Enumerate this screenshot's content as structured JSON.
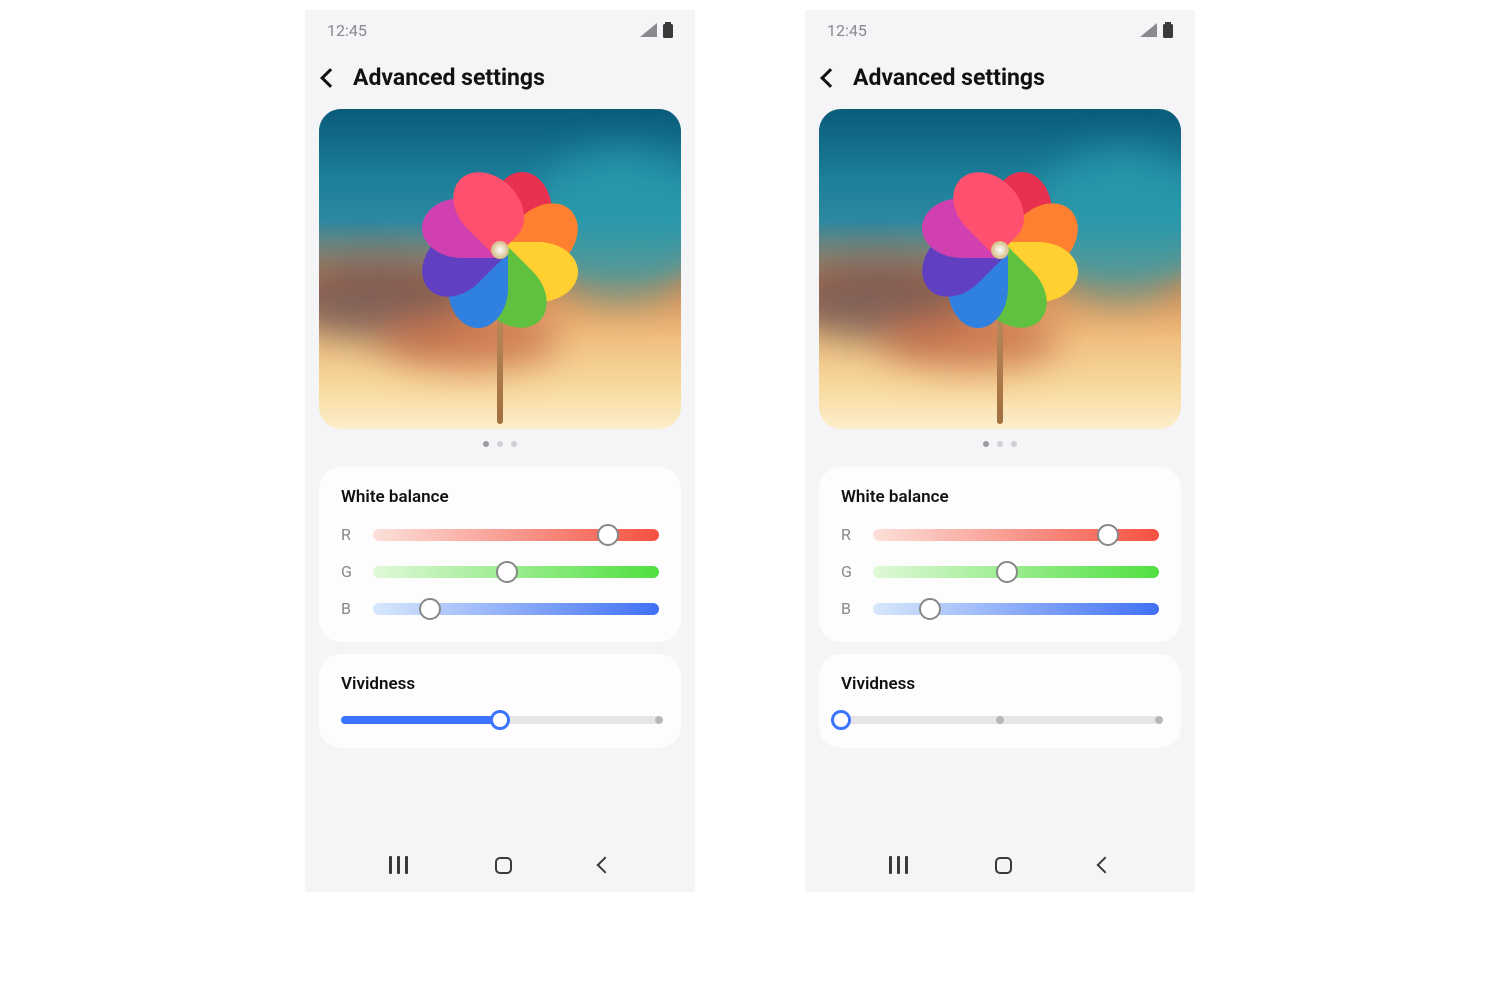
{
  "phones": [
    {
      "status": {
        "time": "12:45"
      },
      "header": {
        "title": "Advanced settings"
      },
      "white_balance": {
        "title": "White balance",
        "r": {
          "label": "R",
          "value": 82
        },
        "g": {
          "label": "G",
          "value": 47
        },
        "b": {
          "label": "B",
          "value": 20
        }
      },
      "vividness": {
        "title": "Vividness",
        "value": 50,
        "ticks": [
          0,
          50,
          100
        ]
      }
    },
    {
      "status": {
        "time": "12:45"
      },
      "header": {
        "title": "Advanced settings"
      },
      "white_balance": {
        "title": "White balance",
        "r": {
          "label": "R",
          "value": 82
        },
        "g": {
          "label": "G",
          "value": 47
        },
        "b": {
          "label": "B",
          "value": 20
        }
      },
      "vividness": {
        "title": "Vividness",
        "value": 0,
        "ticks": [
          0,
          50,
          100
        ]
      }
    }
  ]
}
